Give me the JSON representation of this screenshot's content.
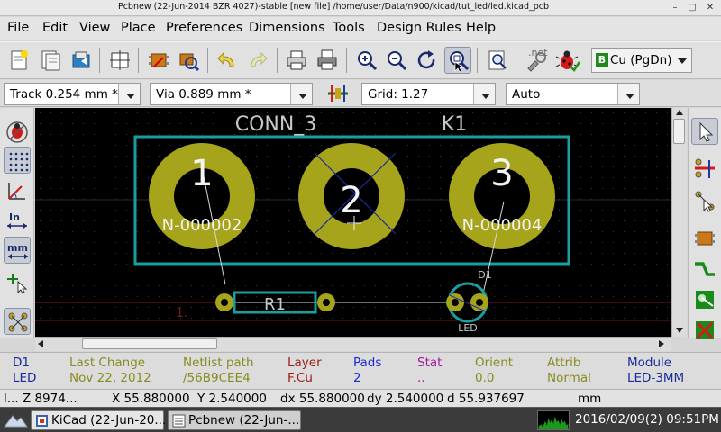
{
  "window": {
    "title": "Pcbnew (22-Jun-2014 BZR 4027)-stable  [new file] /home/user/Data/n900/kicad/tut_led/led.kicad_pcb",
    "buttons": [
      "minimize-icon",
      "maximize-icon",
      "close-icon"
    ]
  },
  "menu": [
    "File",
    "Edit",
    "View",
    "Place",
    "Preferences",
    "Dimensions",
    "Tools",
    "Design Rules",
    "Help"
  ],
  "toolbar": {
    "net_label": ".net",
    "layer": "Cu (PgDn)",
    "layer_badge": "B",
    "layer_color": "#1c8a1c",
    "icons": [
      "new-board-icon",
      "open-board-icon",
      "save-board-icon",
      "page-settings-icon",
      "module-editor-icon",
      "module-viewer-icon",
      "undo-icon",
      "redo-icon",
      "print-icon",
      "plot-icon",
      "zoom-in-icon",
      "zoom-out-icon",
      "redraw-icon",
      "zoom-fit-icon",
      "find-icon",
      "netlist-icon",
      "drc-icon"
    ]
  },
  "options": {
    "track": "Track 0.254 mm *",
    "via": "Via 0.889 mm *",
    "grid": "Grid: 1.27",
    "zoom": "Auto"
  },
  "left_tools": [
    "drc-off-icon",
    "grid-show-icon",
    "polar-coords-icon",
    "inch-units-icon",
    "mm-units-icon",
    "cursor-shape-icon",
    "ratsnest-icon"
  ],
  "right_tools": [
    "select-arrow-icon",
    "highlight-net-icon",
    "local-ratsnest-icon",
    "add-module-icon",
    "route-track-icon",
    "add-zone-icon",
    "delete-icon"
  ],
  "board": {
    "component_value": "CONN_3",
    "component_ref": "K1",
    "pads": [
      {
        "number": "1",
        "net": "N-000002"
      },
      {
        "number": "2",
        "net": ""
      },
      {
        "number": "3",
        "net": "N-000004"
      }
    ],
    "resistor_ref": "R1",
    "led_ref": "D1",
    "led_value": "LED",
    "marker": "1.",
    "colors": {
      "background": "#000000",
      "pad": "#a6a41a",
      "silk": "#18a0a0",
      "ratsnest": "#c8c8c8",
      "text": "#e0e0e0"
    }
  },
  "message_panel": [
    {
      "label": "D1",
      "value": "LED",
      "color": "#1a2a9a"
    },
    {
      "label": "Last Change",
      "value": "Nov 22, 2012",
      "color": "#8a8a20"
    },
    {
      "label": "Netlist path",
      "value": "/56B9CEE4",
      "color": "#8a8a20"
    },
    {
      "label": "Layer",
      "value": "F.Cu",
      "color": "#a01a1a"
    },
    {
      "label": "Pads",
      "value": "2",
      "color": "#1a2acc"
    },
    {
      "label": "Stat",
      "value": "..",
      "color": "#a01aa0"
    },
    {
      "label": "Orient",
      "value": "0.0",
      "color": "#8a8a20"
    },
    {
      "label": "Attrib",
      "value": "Normal",
      "color": "#8a8a20"
    },
    {
      "label": "Module",
      "value": "LED-3MM",
      "color": "#1a2a9a"
    }
  ],
  "status": {
    "zoom": "l...  Z 8974...",
    "x": "X 55.880000",
    "y": "Y 2.540000",
    "dx": "dx 55.880000",
    "dy": "dy 2.540000",
    "d": "d 55.937697",
    "units": "mm"
  },
  "taskbar": {
    "tasks": [
      "KiCad (22-Jun-20...",
      "Pcbnew (22-Jun-..."
    ],
    "clock": "2016/02/09(2) 09:51PM"
  }
}
